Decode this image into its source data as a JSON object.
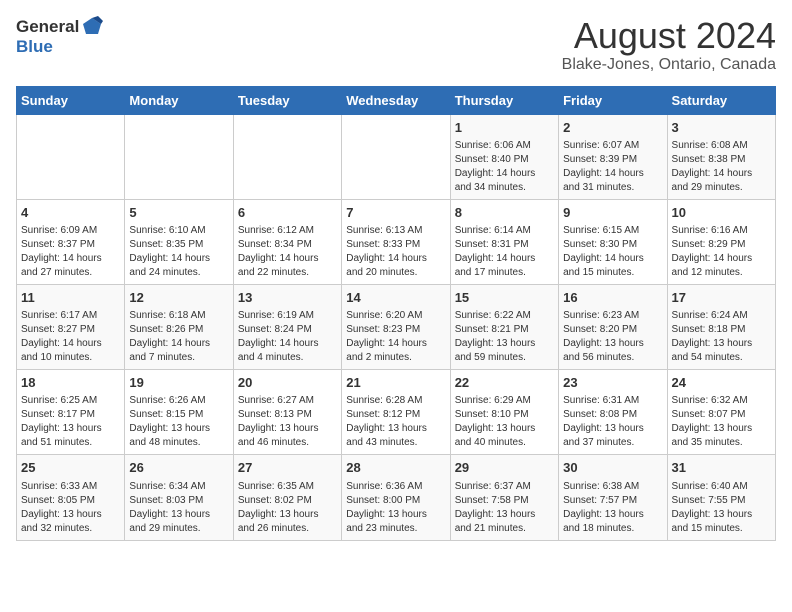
{
  "logo": {
    "text_general": "General",
    "text_blue": "Blue"
  },
  "title": "August 2024",
  "subtitle": "Blake-Jones, Ontario, Canada",
  "days_of_week": [
    "Sunday",
    "Monday",
    "Tuesday",
    "Wednesday",
    "Thursday",
    "Friday",
    "Saturday"
  ],
  "weeks": [
    [
      {
        "day": "",
        "content": ""
      },
      {
        "day": "",
        "content": ""
      },
      {
        "day": "",
        "content": ""
      },
      {
        "day": "",
        "content": ""
      },
      {
        "day": "1",
        "content": "Sunrise: 6:06 AM\nSunset: 8:40 PM\nDaylight: 14 hours\nand 34 minutes."
      },
      {
        "day": "2",
        "content": "Sunrise: 6:07 AM\nSunset: 8:39 PM\nDaylight: 14 hours\nand 31 minutes."
      },
      {
        "day": "3",
        "content": "Sunrise: 6:08 AM\nSunset: 8:38 PM\nDaylight: 14 hours\nand 29 minutes."
      }
    ],
    [
      {
        "day": "4",
        "content": "Sunrise: 6:09 AM\nSunset: 8:37 PM\nDaylight: 14 hours\nand 27 minutes."
      },
      {
        "day": "5",
        "content": "Sunrise: 6:10 AM\nSunset: 8:35 PM\nDaylight: 14 hours\nand 24 minutes."
      },
      {
        "day": "6",
        "content": "Sunrise: 6:12 AM\nSunset: 8:34 PM\nDaylight: 14 hours\nand 22 minutes."
      },
      {
        "day": "7",
        "content": "Sunrise: 6:13 AM\nSunset: 8:33 PM\nDaylight: 14 hours\nand 20 minutes."
      },
      {
        "day": "8",
        "content": "Sunrise: 6:14 AM\nSunset: 8:31 PM\nDaylight: 14 hours\nand 17 minutes."
      },
      {
        "day": "9",
        "content": "Sunrise: 6:15 AM\nSunset: 8:30 PM\nDaylight: 14 hours\nand 15 minutes."
      },
      {
        "day": "10",
        "content": "Sunrise: 6:16 AM\nSunset: 8:29 PM\nDaylight: 14 hours\nand 12 minutes."
      }
    ],
    [
      {
        "day": "11",
        "content": "Sunrise: 6:17 AM\nSunset: 8:27 PM\nDaylight: 14 hours\nand 10 minutes."
      },
      {
        "day": "12",
        "content": "Sunrise: 6:18 AM\nSunset: 8:26 PM\nDaylight: 14 hours\nand 7 minutes."
      },
      {
        "day": "13",
        "content": "Sunrise: 6:19 AM\nSunset: 8:24 PM\nDaylight: 14 hours\nand 4 minutes."
      },
      {
        "day": "14",
        "content": "Sunrise: 6:20 AM\nSunset: 8:23 PM\nDaylight: 14 hours\nand 2 minutes."
      },
      {
        "day": "15",
        "content": "Sunrise: 6:22 AM\nSunset: 8:21 PM\nDaylight: 13 hours\nand 59 minutes."
      },
      {
        "day": "16",
        "content": "Sunrise: 6:23 AM\nSunset: 8:20 PM\nDaylight: 13 hours\nand 56 minutes."
      },
      {
        "day": "17",
        "content": "Sunrise: 6:24 AM\nSunset: 8:18 PM\nDaylight: 13 hours\nand 54 minutes."
      }
    ],
    [
      {
        "day": "18",
        "content": "Sunrise: 6:25 AM\nSunset: 8:17 PM\nDaylight: 13 hours\nand 51 minutes."
      },
      {
        "day": "19",
        "content": "Sunrise: 6:26 AM\nSunset: 8:15 PM\nDaylight: 13 hours\nand 48 minutes."
      },
      {
        "day": "20",
        "content": "Sunrise: 6:27 AM\nSunset: 8:13 PM\nDaylight: 13 hours\nand 46 minutes."
      },
      {
        "day": "21",
        "content": "Sunrise: 6:28 AM\nSunset: 8:12 PM\nDaylight: 13 hours\nand 43 minutes."
      },
      {
        "day": "22",
        "content": "Sunrise: 6:29 AM\nSunset: 8:10 PM\nDaylight: 13 hours\nand 40 minutes."
      },
      {
        "day": "23",
        "content": "Sunrise: 6:31 AM\nSunset: 8:08 PM\nDaylight: 13 hours\nand 37 minutes."
      },
      {
        "day": "24",
        "content": "Sunrise: 6:32 AM\nSunset: 8:07 PM\nDaylight: 13 hours\nand 35 minutes."
      }
    ],
    [
      {
        "day": "25",
        "content": "Sunrise: 6:33 AM\nSunset: 8:05 PM\nDaylight: 13 hours\nand 32 minutes."
      },
      {
        "day": "26",
        "content": "Sunrise: 6:34 AM\nSunset: 8:03 PM\nDaylight: 13 hours\nand 29 minutes."
      },
      {
        "day": "27",
        "content": "Sunrise: 6:35 AM\nSunset: 8:02 PM\nDaylight: 13 hours\nand 26 minutes."
      },
      {
        "day": "28",
        "content": "Sunrise: 6:36 AM\nSunset: 8:00 PM\nDaylight: 13 hours\nand 23 minutes."
      },
      {
        "day": "29",
        "content": "Sunrise: 6:37 AM\nSunset: 7:58 PM\nDaylight: 13 hours\nand 21 minutes."
      },
      {
        "day": "30",
        "content": "Sunrise: 6:38 AM\nSunset: 7:57 PM\nDaylight: 13 hours\nand 18 minutes."
      },
      {
        "day": "31",
        "content": "Sunrise: 6:40 AM\nSunset: 7:55 PM\nDaylight: 13 hours\nand 15 minutes."
      }
    ]
  ]
}
